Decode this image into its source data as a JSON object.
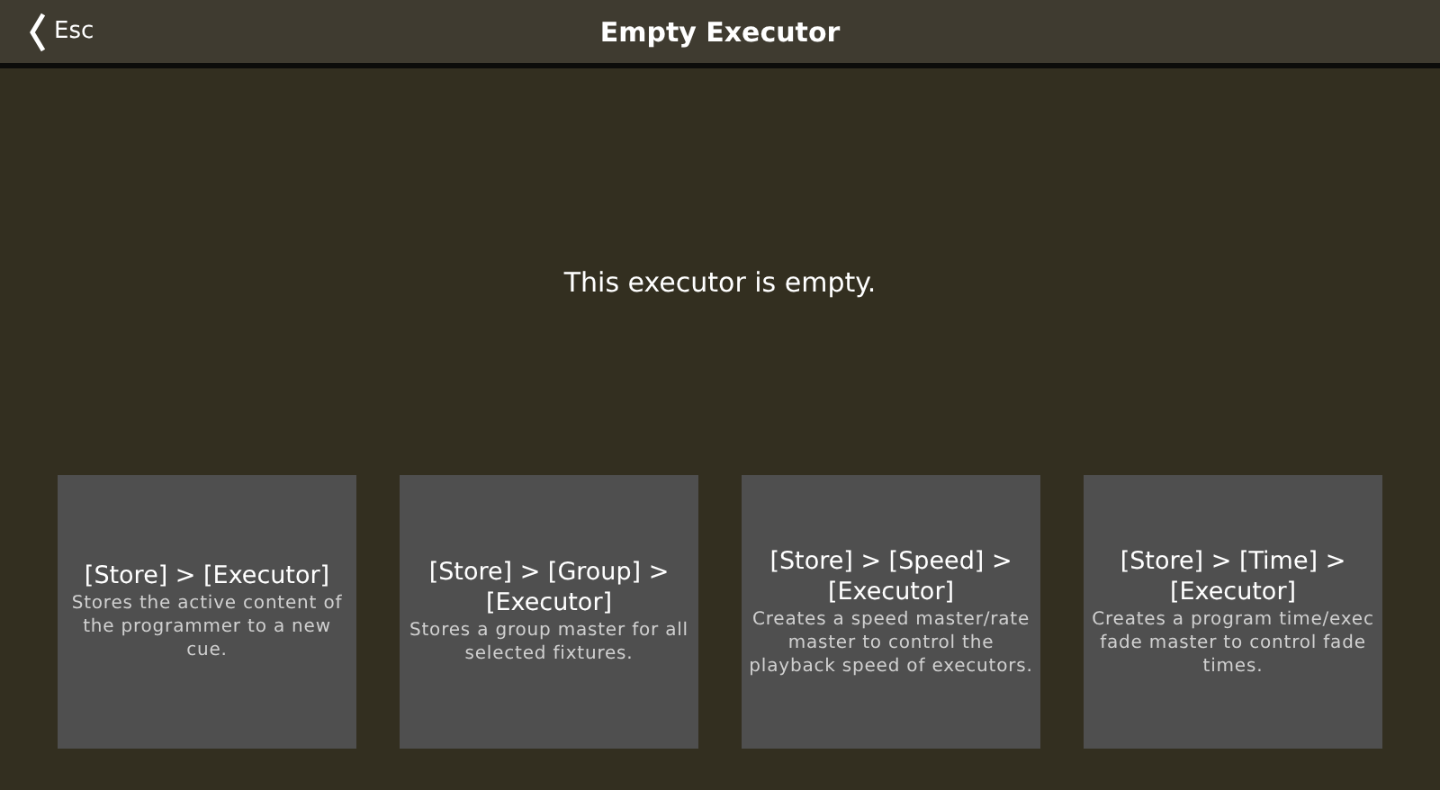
{
  "header": {
    "back_label": "Esc",
    "title": "Empty Executor"
  },
  "message": "This executor is empty.",
  "options": [
    {
      "command": "[Store] > [Executor]",
      "description": "Stores the active content of the programmer to a new cue."
    },
    {
      "command": "[Store] > [Group] > [Executor]",
      "description": "Stores a group master for all selected fixtures."
    },
    {
      "command": "[Store] > [Speed] > [Executor]",
      "description": "Creates a speed master/rate master to control the playback speed of executors."
    },
    {
      "command": "[Store] > [Time] > [Executor]",
      "description": "Creates a program time/exec fade master to control fade times."
    }
  ]
}
